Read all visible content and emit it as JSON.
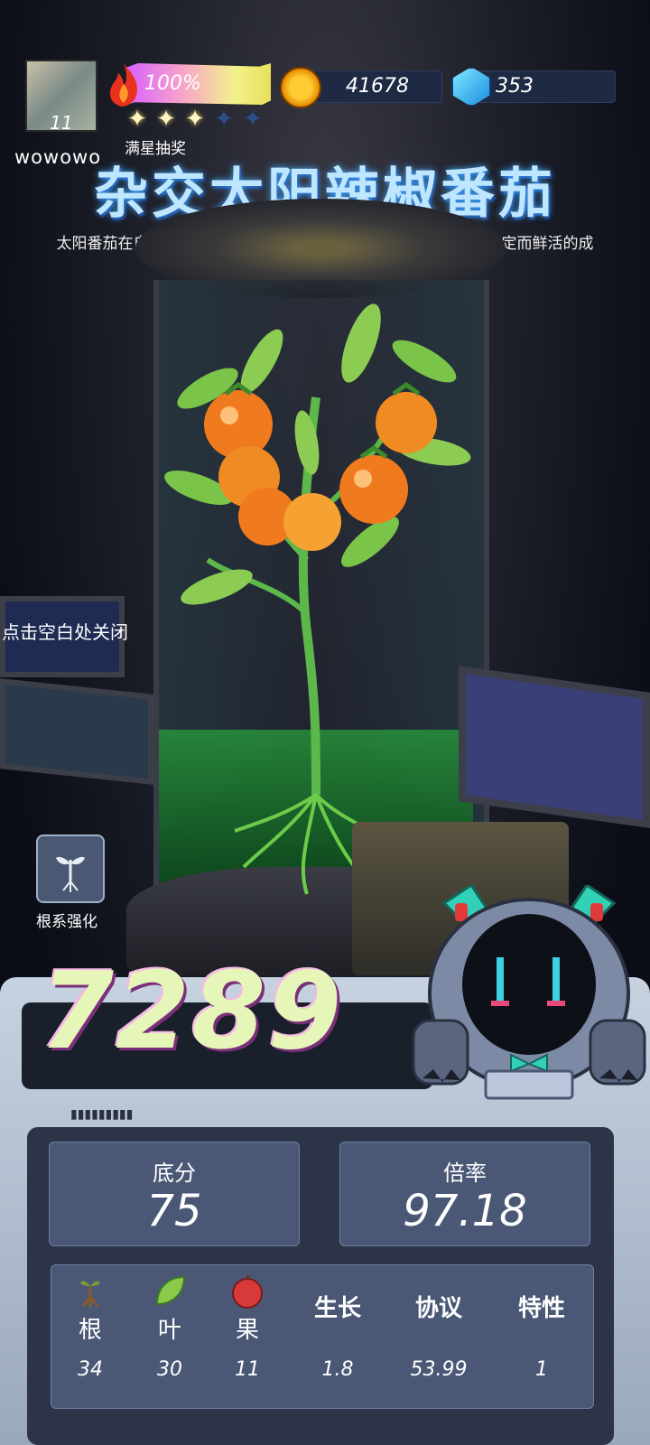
{
  "hud": {
    "avatar_level": "11",
    "username": "wowowo",
    "energy_percent": "100%",
    "stars_filled": 3,
    "stars_total": 5,
    "star_lottery_label": "满星抽奖",
    "gold": "41678",
    "gems": "353"
  },
  "plant": {
    "title": "杂交太阳辣椒番茄",
    "description": "太阳番茄在自然协议的引导下完成进化，果面像蓄着暖光，带着稳定而鲜活的成熟感。"
  },
  "hints": {
    "close": "点击空白处关闭"
  },
  "root_boost": {
    "label": "根系强化",
    "icon": "sprout-icon"
  },
  "score": {
    "total": "7289",
    "base_label": "底分",
    "base_value": "75",
    "multiplier_label": "倍率",
    "multiplier_value": "97.18"
  },
  "attributes": [
    {
      "name": "根",
      "value": "34",
      "icon": "root-icon"
    },
    {
      "name": "叶",
      "value": "30",
      "icon": "leaf-icon"
    },
    {
      "name": "果",
      "value": "11",
      "icon": "apple-icon"
    },
    {
      "name": "生长",
      "value": "1.8"
    },
    {
      "name": "协议",
      "value": "53.99"
    },
    {
      "name": "特性",
      "value": "1"
    }
  ],
  "colors": {
    "title": "#bfe6ff",
    "score": "#e6f5b8",
    "panel": "#4a5876",
    "liquid": "#28a03c"
  }
}
